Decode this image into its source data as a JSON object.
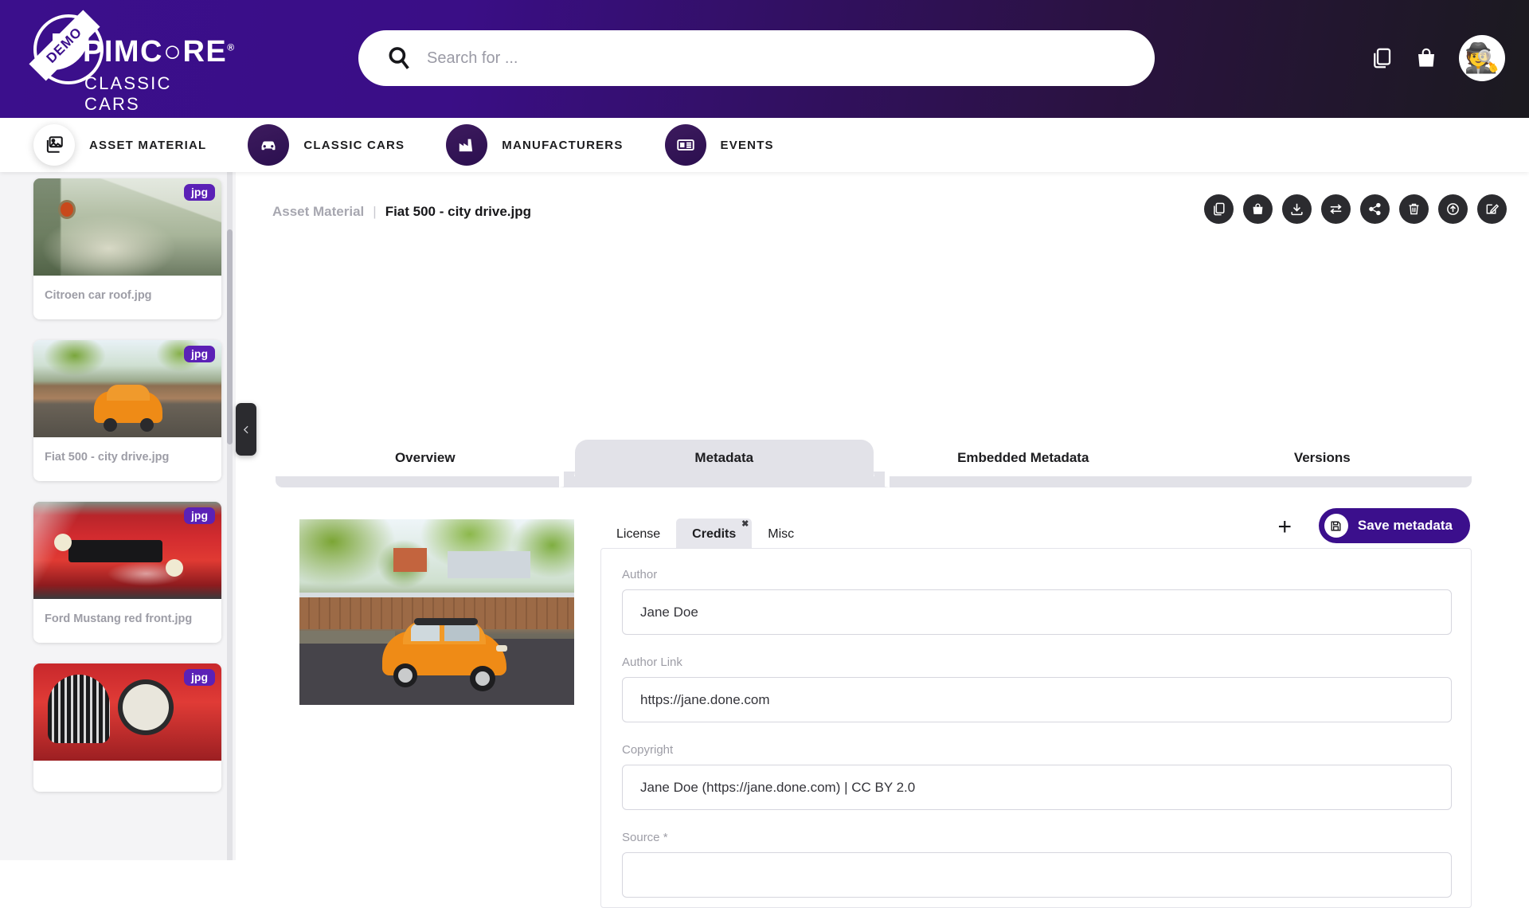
{
  "header": {
    "logo": {
      "badge": "DEMO",
      "brand": "PIMC○RE",
      "registered": "®",
      "subtitle": "CLASSIC CARS"
    },
    "search": {
      "placeholder": "Search for ...",
      "value": ""
    },
    "icons": [
      {
        "name": "copy-icon",
        "label": "Copy"
      },
      {
        "name": "shopping-bag-icon",
        "label": "Portfolio"
      }
    ],
    "avatar": {
      "name": "user-avatar",
      "emoji": "🕵️"
    }
  },
  "nav": {
    "items": [
      {
        "label": "ASSET MATERIAL",
        "icon": "images-icon",
        "active": true
      },
      {
        "label": "CLASSIC CARS",
        "icon": "car-icon",
        "active": false
      },
      {
        "label": "MANUFACTURERS",
        "icon": "factory-icon",
        "active": false
      },
      {
        "label": "EVENTS",
        "icon": "news-card-icon",
        "active": false
      }
    ]
  },
  "sidebar": {
    "items": [
      {
        "name": "Citroen car roof.jpg",
        "badge": "jpg"
      },
      {
        "name": "Fiat 500 - city drive.jpg",
        "badge": "jpg"
      },
      {
        "name": "Ford Mustang red front.jpg",
        "badge": "jpg"
      },
      {
        "name": "",
        "badge": "jpg"
      }
    ],
    "collapse_label": "‹"
  },
  "breadcrumb": {
    "root": "Asset Material",
    "separator": "|",
    "current": "Fiat 500 - city drive.jpg"
  },
  "toolbar": {
    "buttons": [
      {
        "name": "copy-button",
        "icon": "copy-icon"
      },
      {
        "name": "add-to-bag-button",
        "icon": "lock-bag-icon"
      },
      {
        "name": "download-button",
        "icon": "download-icon"
      },
      {
        "name": "swap-button",
        "icon": "transfer-icon"
      },
      {
        "name": "share-button",
        "icon": "share-icon"
      },
      {
        "name": "delete-button",
        "icon": "trash-icon"
      },
      {
        "name": "upload-button",
        "icon": "upload-circle-icon"
      },
      {
        "name": "edit-button",
        "icon": "edit-pencil-icon"
      }
    ]
  },
  "tabs": [
    {
      "label": "Overview",
      "active": false
    },
    {
      "label": "Metadata",
      "active": true
    },
    {
      "label": "Embedded Metadata",
      "active": false
    },
    {
      "label": "Versions",
      "active": false
    }
  ],
  "subtabs": [
    {
      "label": "License",
      "active": false,
      "closable": false
    },
    {
      "label": "Credits",
      "active": true,
      "closable": true,
      "close": "✖"
    },
    {
      "label": "Misc",
      "active": false,
      "closable": false
    }
  ],
  "actions": {
    "add_label": "+",
    "save_label": "Save metadata",
    "save_icon": "floppy-disk-icon"
  },
  "form": {
    "fields": [
      {
        "label": "Author",
        "value": "Jane Doe",
        "placeholder": "",
        "required": false
      },
      {
        "label": "Author Link",
        "value": "https://jane.done.com",
        "placeholder": "",
        "required": false
      },
      {
        "label": "Copyright",
        "value": "Jane Doe (https://jane.done.com) | CC BY 2.0",
        "placeholder": "",
        "required": false
      },
      {
        "label": "Source *",
        "value": "",
        "placeholder": "",
        "required": true
      }
    ]
  },
  "preview": {
    "alt": "Fiat 500 - city drive.jpg"
  },
  "colors": {
    "brand_purple": "#3b0f8c",
    "header_gradient_start": "#3b0f8c",
    "header_gradient_end": "#1b1a1f",
    "badge_purple": "#5b21b6",
    "dark_button": "#2b2b2f",
    "tab_active_bg": "#e2e2e8",
    "sidebar_bg": "#f4f4f6"
  }
}
